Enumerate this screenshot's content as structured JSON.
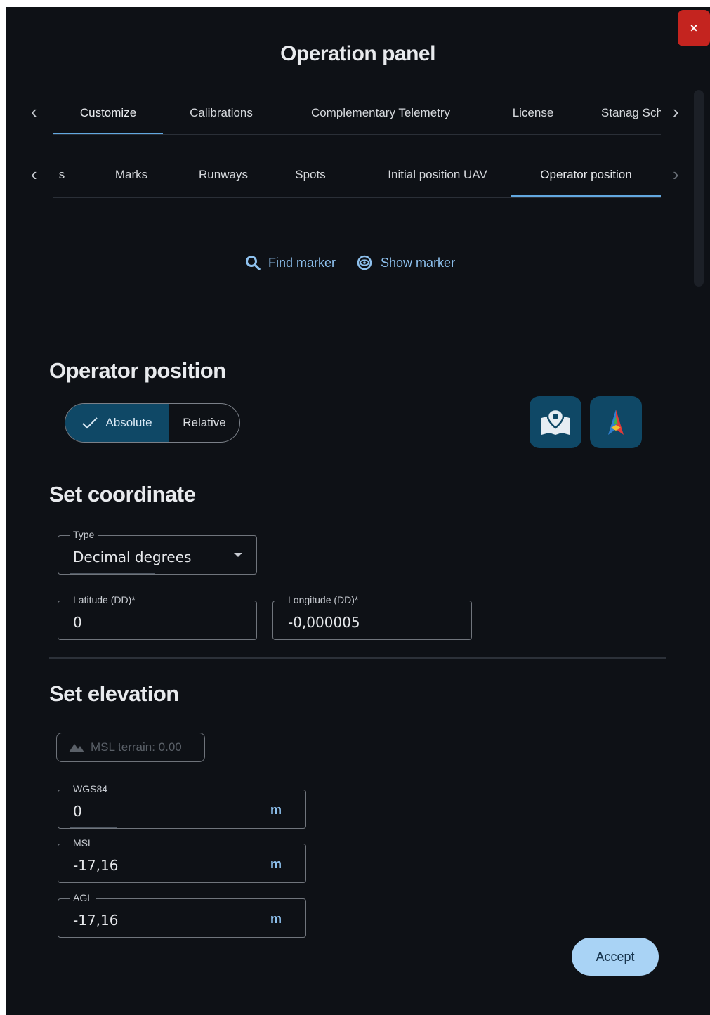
{
  "header": {
    "title": "Operation panel",
    "close_label": "×"
  },
  "tabs_primary": {
    "items": [
      "Customize",
      "Calibrations",
      "Complementary Telemetry",
      "License",
      "Stanag Sch"
    ],
    "active": "Customize",
    "prev_arrow": "‹",
    "next_arrow": "›"
  },
  "tabs_secondary": {
    "items": [
      "s",
      "Marks",
      "Runways",
      "Spots",
      "Initial position UAV",
      "Operator position"
    ],
    "active": "Operator position",
    "prev_arrow": "‹",
    "next_arrow": "›"
  },
  "marker_actions": {
    "find": "Find marker",
    "show": "Show marker"
  },
  "operator_position": {
    "title": "Operator position",
    "mode_absolute": "Absolute",
    "mode_relative": "Relative",
    "selected_mode": "Absolute",
    "map_button_icon": "map-pin-icon",
    "arrow_button_icon": "tricolor-arrow-icon"
  },
  "coordinate": {
    "title": "Set coordinate",
    "type_label": "Type",
    "type_value": "Decimal degrees",
    "latitude_label": "Latitude (DD)*",
    "latitude_value": "0",
    "longitude_label": "Longitude (DD)*",
    "longitude_value": "-0,000005"
  },
  "elevation": {
    "title": "Set elevation",
    "msl_terrain": "MSL terrain: 0.00",
    "wgs84_label": "WGS84",
    "wgs84_value": "0",
    "msl_label": "MSL",
    "msl_value": "-17,16",
    "agl_label": "AGL",
    "agl_value": "-17,16",
    "unit": "m"
  },
  "actions": {
    "accept": "Accept"
  },
  "colors": {
    "panel_bg": "#0e1116",
    "accent": "#62a8e0",
    "button_bg": "#0f4866",
    "accept_bg": "#a9d3f5",
    "close_bg": "#c4241f"
  }
}
